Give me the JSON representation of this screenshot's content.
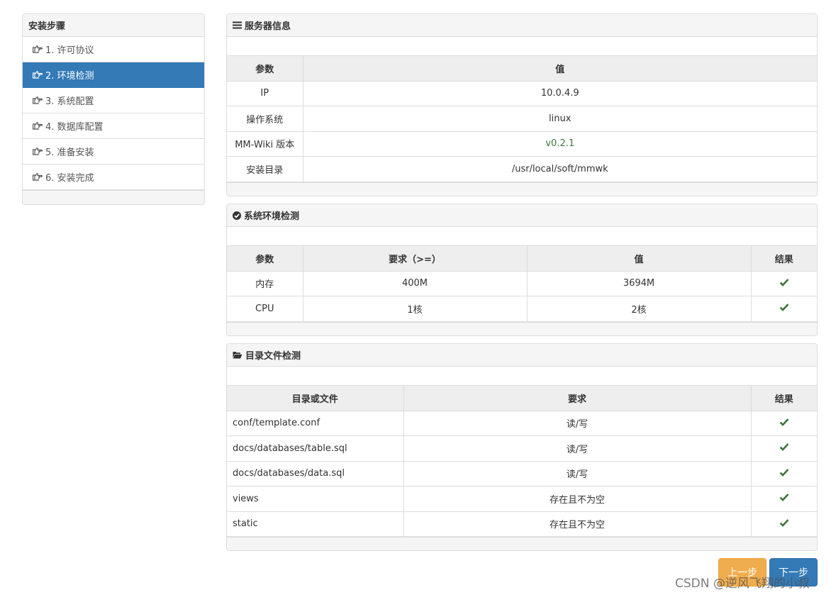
{
  "sidebar": {
    "title": "安装步骤",
    "items": [
      {
        "label": "1. 许可协议",
        "active": false
      },
      {
        "label": "2. 环境检测",
        "active": true
      },
      {
        "label": "3. 系统配置",
        "active": false
      },
      {
        "label": "4. 数据库配置",
        "active": false
      },
      {
        "label": "5. 准备安装",
        "active": false
      },
      {
        "label": "6. 安装完成",
        "active": false
      }
    ]
  },
  "server_info": {
    "title": "服务器信息",
    "headers": [
      "参数",
      "值"
    ],
    "rows": [
      {
        "param": "IP",
        "value": "10.0.4.9"
      },
      {
        "param": "操作系统",
        "value": "linux"
      },
      {
        "param": "MM-Wiki 版本",
        "value": "v0.2.1"
      },
      {
        "param": "安装目录",
        "value": "/usr/local/soft/mmwk"
      }
    ]
  },
  "env_check": {
    "title": "系统环境检测",
    "headers": [
      "参数",
      "要求（>=）",
      "值",
      "结果"
    ],
    "rows": [
      {
        "param": "内存",
        "require": "400M",
        "value": "3694M",
        "result": "check"
      },
      {
        "param": "CPU",
        "require": "1核",
        "value": "2核",
        "result": "check"
      }
    ]
  },
  "file_check": {
    "title": "目录文件检测",
    "headers": [
      "目录或文件",
      "要求",
      "结果"
    ],
    "rows": [
      {
        "path": "conf/template.conf",
        "require": "读/写",
        "result": "check"
      },
      {
        "path": "docs/databases/table.sql",
        "require": "读/写",
        "result": "check"
      },
      {
        "path": "docs/databases/data.sql",
        "require": "读/写",
        "result": "check"
      },
      {
        "path": "views",
        "require": "存在且不为空",
        "result": "check"
      },
      {
        "path": "static",
        "require": "存在且不为空",
        "result": "check"
      }
    ]
  },
  "buttons": {
    "prev": "上一步",
    "next": "下一步"
  },
  "watermark": "CSDN @逆风飞翔的小叔",
  "colors": {
    "primary": "#337ab7",
    "warning": "#f0ad4e",
    "success": "#3c763d"
  }
}
